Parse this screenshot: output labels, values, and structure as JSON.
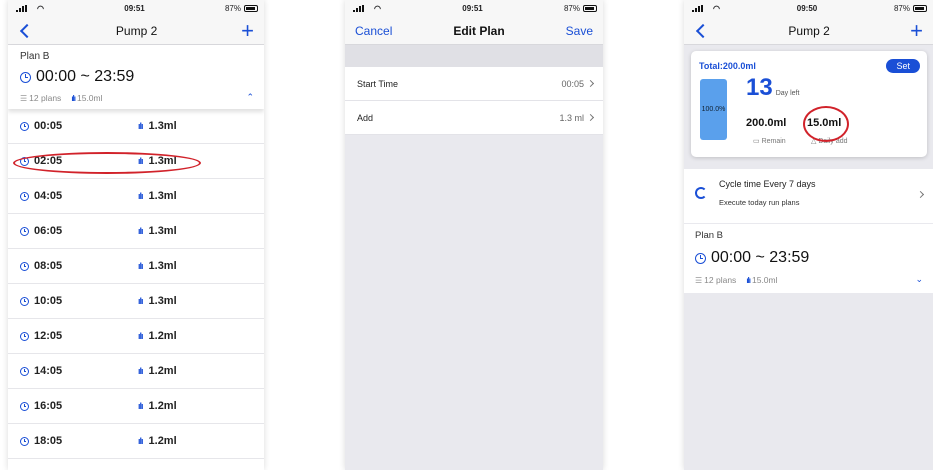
{
  "colors": {
    "accent": "#1a4fd6",
    "annotation": "#d1222a"
  },
  "phone1": {
    "status": {
      "time": "09:51",
      "battery": "87%"
    },
    "title": "Pump 2",
    "plan": {
      "name": "Plan B",
      "range": "00:00 ~ 23:59",
      "plans": "12 plans",
      "amount": "15.0ml"
    },
    "rows": [
      {
        "time": "00:05",
        "amount": "1.3ml"
      },
      {
        "time": "02:05",
        "amount": "1.3ml"
      },
      {
        "time": "04:05",
        "amount": "1.3ml"
      },
      {
        "time": "06:05",
        "amount": "1.3ml"
      },
      {
        "time": "08:05",
        "amount": "1.3ml"
      },
      {
        "time": "10:05",
        "amount": "1.3ml"
      },
      {
        "time": "12:05",
        "amount": "1.2ml"
      },
      {
        "time": "14:05",
        "amount": "1.2ml"
      },
      {
        "time": "16:05",
        "amount": "1.2ml"
      },
      {
        "time": "18:05",
        "amount": "1.2ml"
      }
    ]
  },
  "phone2": {
    "status": {
      "time": "09:51",
      "battery": "87%"
    },
    "cancel": "Cancel",
    "title": "Edit Plan",
    "save": "Save",
    "fields": [
      {
        "label": "Start Time",
        "value": "00:05"
      },
      {
        "label": "Add",
        "value": "1.3 ml"
      }
    ]
  },
  "phone3": {
    "status": {
      "time": "09:50",
      "battery": "87%"
    },
    "title": "Pump 2",
    "card": {
      "total": "Total:200.0ml",
      "set": "Set",
      "tank_percent": "100.0%",
      "days": "13",
      "days_label": "Day left",
      "remain_value": "200.0ml",
      "remain_label": "Remain",
      "daily_value": "15.0ml",
      "daily_label": "Daily add"
    },
    "cycle": {
      "title": "Cycle time   Every 7 days",
      "subtitle": "Execute today run plans"
    },
    "plan": {
      "name": "Plan B",
      "range": "00:00 ~ 23:59",
      "plans": "12 plans",
      "amount": "15.0ml"
    }
  }
}
